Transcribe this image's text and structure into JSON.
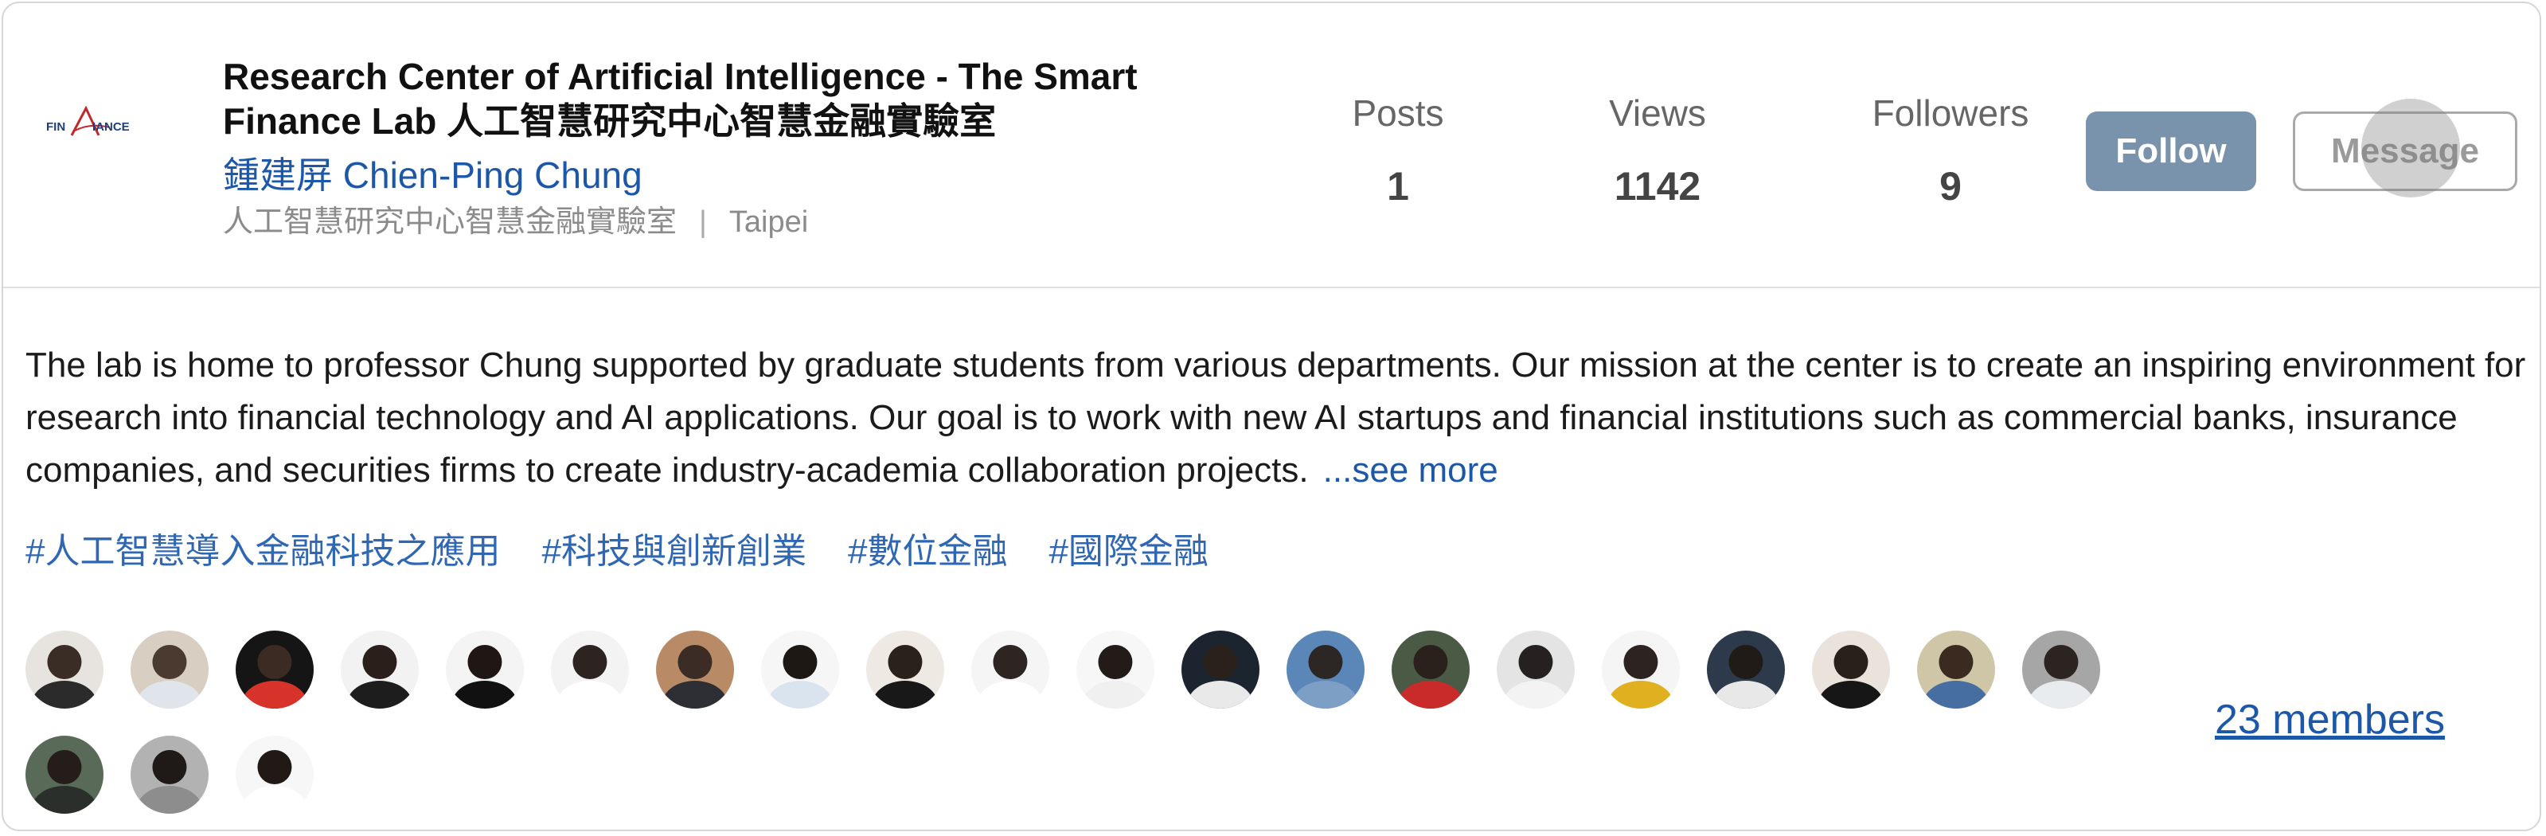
{
  "header": {
    "logo_text": "FINALLIANCE",
    "title": "Research Center of Artificial Intelligence - The Smart Finance Lab 人工智慧研究中心智慧金融實驗室",
    "owner": "鍾建屏 Chien-Ping Chung",
    "department": "人工智慧研究中心智慧金融實驗室",
    "separator": "|",
    "location": "Taipei"
  },
  "stats": [
    {
      "label": "Posts",
      "value": "1"
    },
    {
      "label": "Views",
      "value": "1142"
    },
    {
      "label": "Followers",
      "value": "9"
    }
  ],
  "actions": {
    "follow": "Follow",
    "message": "Message"
  },
  "description": {
    "text": "The lab is home to professor Chung supported by graduate students from various departments. Our mission at the center is to create an inspiring environment for research into financial technology and AI applications. Our goal is to work with new AI startups and financial institutions such as commercial banks, insurance companies, and securities firms to create industry-academia collaboration projects.",
    "see_more": "...see more"
  },
  "tags": [
    "#人工智慧導入金融科技之應用",
    "#科技與創新創業",
    "#數位金融",
    "#國際金融"
  ],
  "members_link": "23 members",
  "colors": {
    "accent_blue": "#1d57a8",
    "follow_button": "#7a93ad",
    "tag_blue": "#2f67b3"
  }
}
